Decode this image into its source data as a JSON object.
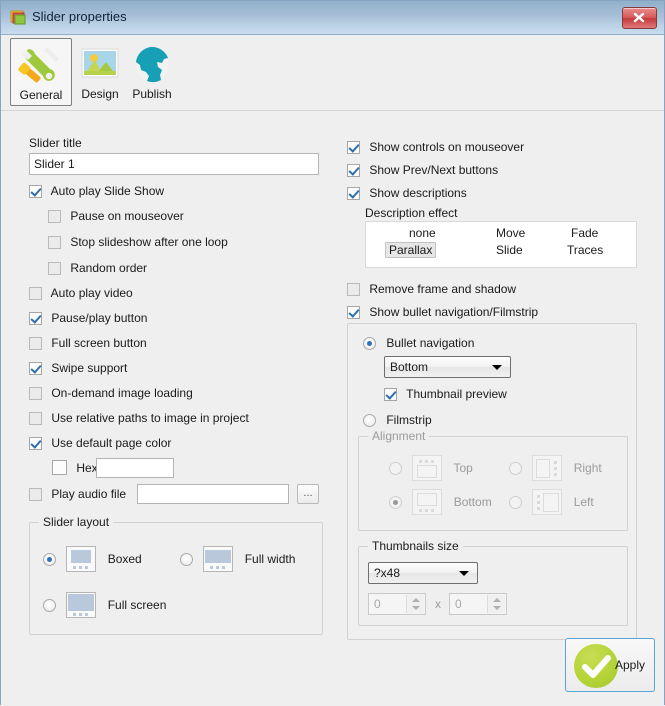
{
  "window": {
    "title": "Slider properties",
    "icon": "image-icon",
    "close_label": "close-icon"
  },
  "tabs": [
    {
      "id": "general",
      "label": "General",
      "icon": "wrench-screwdriver-icon",
      "selected": true
    },
    {
      "id": "design",
      "label": "Design",
      "icon": "landscape-image-icon",
      "selected": false
    },
    {
      "id": "publish",
      "label": "Publish",
      "icon": "globe-icon",
      "selected": false
    }
  ],
  "left": {
    "slider_title_label": "Slider title",
    "slider_title_value": "Slider 1",
    "checks": {
      "auto_play_slideshow": "Auto play Slide Show",
      "pause_on_mouseover": "Pause on mouseover",
      "stop_after_one_loop": "Stop slideshow after one loop",
      "random_order": "Random order",
      "auto_play_video": "Auto play video",
      "pause_play_button": "Pause/play button",
      "full_screen_button": "Full screen button",
      "swipe_support": "Swipe support",
      "on_demand_loading": "On-demand image loading",
      "relative_paths": "Use relative paths to image in project",
      "default_page_color": "Use default page color",
      "hex": "Hex",
      "play_audio_file": "Play audio file"
    },
    "hex_value": "",
    "audio_value": "",
    "browse_label": "...",
    "layout_group": "Slider layout",
    "layout_options": [
      {
        "id": "boxed",
        "label": "Boxed",
        "selected": true
      },
      {
        "id": "full-width",
        "label": "Full width",
        "selected": false
      },
      {
        "id": "full-screen",
        "label": "Full screen",
        "selected": false
      }
    ]
  },
  "right": {
    "checks": {
      "show_controls": "Show controls on mouseover",
      "show_prev_next": "Show Prev/Next buttons",
      "show_descriptions": "Show descriptions",
      "remove_frame": "Remove frame and shadow",
      "show_bullet_nav": "Show bullet navigation/Filmstrip",
      "thumbnail_preview": "Thumbnail preview"
    },
    "description_effect_label": "Description effect",
    "description_effects": [
      {
        "label": "none",
        "selected": false
      },
      {
        "label": "Move",
        "selected": false
      },
      {
        "label": "Fade",
        "selected": false
      },
      {
        "label": "Parallax",
        "selected": true
      },
      {
        "label": "Slide",
        "selected": false
      },
      {
        "label": "Traces",
        "selected": false
      }
    ],
    "bullet_navigation_label": "Bullet navigation",
    "bullet_position_value": "Bottom",
    "filmstrip_label": "Filmstrip",
    "alignment_group": "Alignment",
    "alignment_options": [
      {
        "id": "top",
        "label": "Top",
        "selected": false
      },
      {
        "id": "right",
        "label": "Right",
        "selected": false
      },
      {
        "id": "bottom",
        "label": "Bottom",
        "selected": true
      },
      {
        "id": "left",
        "label": "Left",
        "selected": false
      }
    ],
    "thumbnails_size_group": "Thumbnails size",
    "thumbnails_size_value": "?x48",
    "thumb_width_value": "0",
    "thumb_height_value": "0",
    "thumb_x_separator": "x"
  },
  "footer": {
    "apply_label": "Apply"
  },
  "colors": {
    "titlebar_top": "#91afcb",
    "titlebar_bottom": "#cadcee",
    "dialog_bg": "#efefef",
    "accent_check": "#2f6fad",
    "apply_green": "#b5d437",
    "close_red": "#c43a3a"
  }
}
